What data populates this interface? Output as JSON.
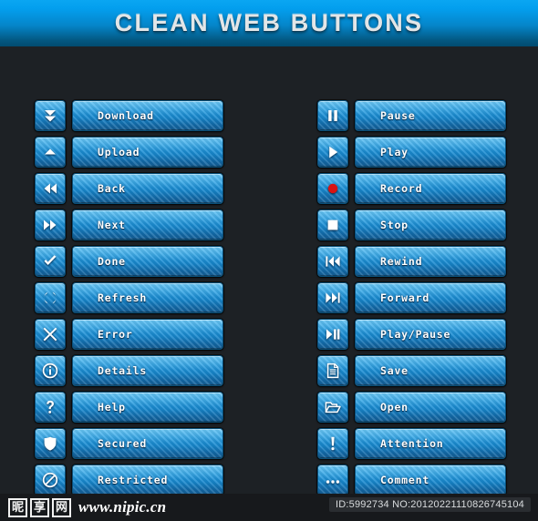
{
  "header": {
    "title": "CLEAN WEB BUTTONS",
    "gradient_top": "#0aa6f2",
    "gradient_bottom": "#024b70"
  },
  "theme": {
    "background": "#1d2125",
    "button_blue_light": "#3fb6f2",
    "button_blue_dark": "#155f95",
    "label_color": "#ffffff",
    "record_red": "#d81313"
  },
  "columns": {
    "left": [
      {
        "label": "Download",
        "icon": "double-chevron-down-icon"
      },
      {
        "label": "Upload",
        "icon": "triangle-up-icon"
      },
      {
        "label": "Back",
        "icon": "double-triangle-left-icon"
      },
      {
        "label": "Next",
        "icon": "double-triangle-right-icon"
      },
      {
        "label": "Done",
        "icon": "check-icon"
      },
      {
        "label": "Refresh",
        "icon": "refresh-arcs-icon"
      },
      {
        "label": "Error",
        "icon": "x-cross-icon"
      },
      {
        "label": "Details",
        "icon": "info-circle-icon"
      },
      {
        "label": "Help",
        "icon": "question-mark-icon"
      },
      {
        "label": "Secured",
        "icon": "shield-icon"
      },
      {
        "label": "Restricted",
        "icon": "no-entry-icon"
      }
    ],
    "right": [
      {
        "label": "Pause",
        "icon": "pause-icon"
      },
      {
        "label": "Play",
        "icon": "play-icon"
      },
      {
        "label": "Record",
        "icon": "record-circle-icon"
      },
      {
        "label": "Stop",
        "icon": "stop-square-icon"
      },
      {
        "label": "Rewind",
        "icon": "rewind-icon"
      },
      {
        "label": "Forward",
        "icon": "fast-forward-icon"
      },
      {
        "label": "Play/Pause",
        "icon": "play-pause-icon"
      },
      {
        "label": "Save",
        "icon": "document-icon"
      },
      {
        "label": "Open",
        "icon": "folder-open-icon"
      },
      {
        "label": "Attention",
        "icon": "exclamation-icon"
      },
      {
        "label": "Comment",
        "icon": "ellipsis-icon"
      }
    ]
  },
  "footer": {
    "logo_chars": [
      "昵",
      "享",
      "网"
    ],
    "site_url": "www.nipic.cn",
    "watermark": "ID:5992734 NO:20120221110826745104"
  }
}
